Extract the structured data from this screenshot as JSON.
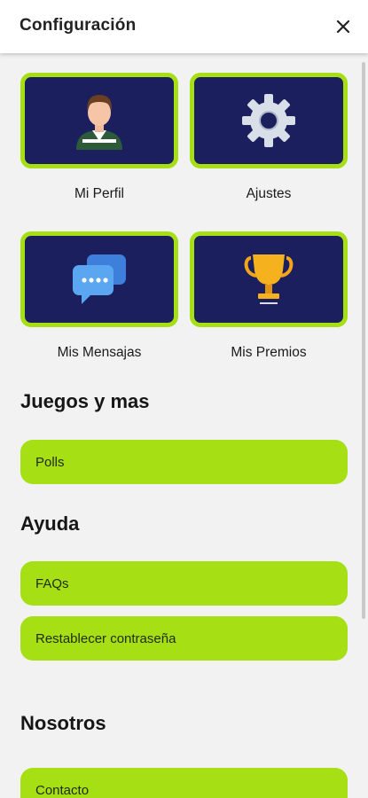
{
  "header": {
    "title": "Configuración",
    "close_icon": "close-icon"
  },
  "tiles": [
    {
      "label": "Mi Perfil",
      "icon": "user-avatar-icon"
    },
    {
      "label": "Ajustes",
      "icon": "gear-icon"
    },
    {
      "label": "Mis Mensajas",
      "icon": "chat-bubbles-icon"
    },
    {
      "label": "Mis Premios",
      "icon": "trophy-icon"
    }
  ],
  "sections": {
    "games": {
      "title": "Juegos y mas",
      "items": [
        "Polls"
      ]
    },
    "help": {
      "title": "Ayuda",
      "items": [
        "FAQs",
        "Restablecer contraseña"
      ]
    },
    "about": {
      "title": "Nosotros",
      "items": [
        "Contacto"
      ]
    }
  },
  "colors": {
    "accent": "#a6df14",
    "tile_background": "#1b1f5e",
    "page_background": "#f2f2f2"
  }
}
